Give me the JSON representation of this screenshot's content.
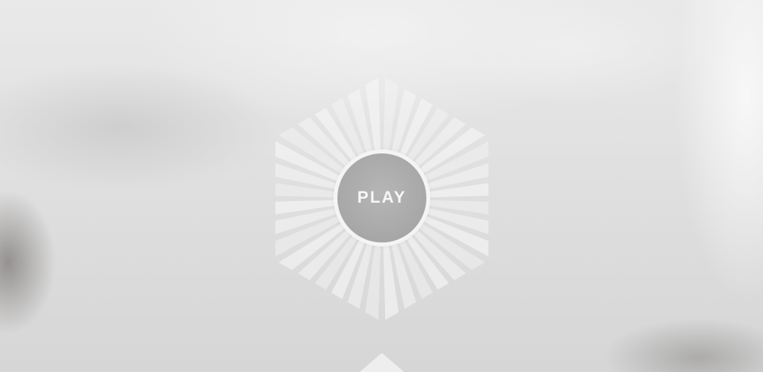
{
  "play_button": {
    "label": "PLAY"
  },
  "icons": {
    "sunburst": "hexagon-sunburst-icon",
    "scroll": "chevron-up-icon"
  },
  "colors": {
    "button_fill": "#a9a9a9",
    "button_ring": "#f4f4f4",
    "ray_fill": "#f6f6f6",
    "background": "#e6e6e6"
  }
}
